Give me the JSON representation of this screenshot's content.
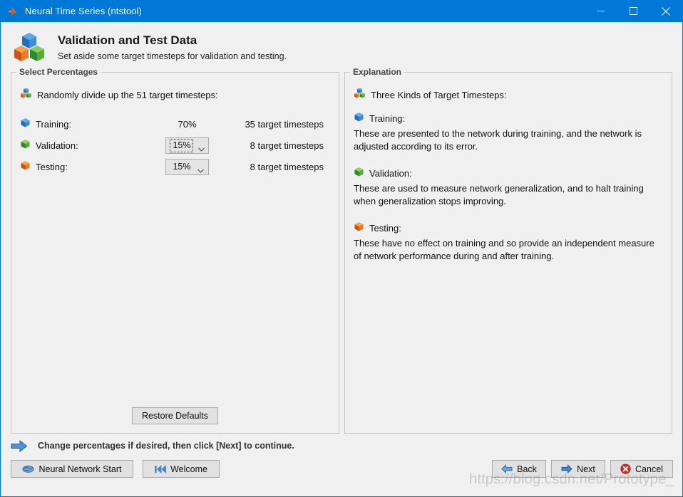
{
  "window": {
    "title": "Neural Time Series (ntstool)",
    "app_icon": "matlab-logo-icon",
    "minimize_label": "─",
    "maximize_label": "□",
    "close_label": "✕",
    "titlebar_color": "#0078d7"
  },
  "header": {
    "icon": "three-cubes-icon",
    "title": "Validation and Test Data",
    "subtitle": "Set aside some target timesteps for validation and testing."
  },
  "select_percentages": {
    "group_title": "Select Percentages",
    "intro_icon": "three-cubes-icon",
    "intro": "Randomly divide up the 51 target timesteps:",
    "rows": [
      {
        "icon": "blue-cube-icon",
        "icon_color": "#2e7bc4",
        "label": "Training:",
        "value": "70%",
        "editable": false,
        "count": "35 target timesteps"
      },
      {
        "icon": "green-cube-icon",
        "icon_color": "#3ea23e",
        "label": "Validation:",
        "value": "15%",
        "editable": true,
        "focused": true,
        "count": "8 target timesteps"
      },
      {
        "icon": "orange-cube-icon",
        "icon_color": "#e8701a",
        "label": "Testing:",
        "value": "15%",
        "editable": true,
        "focused": false,
        "count": "8 target timesteps"
      }
    ],
    "restore_button": "Restore Defaults"
  },
  "explanation": {
    "group_title": "Explanation",
    "heading_icon": "three-cubes-icon",
    "heading": "Three Kinds of Target Timesteps:",
    "sections": [
      {
        "icon": "blue-cube-icon",
        "title": "Training:",
        "body": "These are presented to the network during training, and the network is adjusted according to its error."
      },
      {
        "icon": "green-cube-icon",
        "title": "Validation:",
        "body": "These are used to measure network generalization, and to halt training when generalization stops improving."
      },
      {
        "icon": "orange-cube-icon",
        "title": "Testing:",
        "body": "These have no effect on training and so provide an independent measure of network performance during and after training."
      }
    ]
  },
  "hint": {
    "icon": "blue-right-arrow-icon",
    "text": "Change percentages if desired, then click [Next] to continue."
  },
  "footer": {
    "neural_network_start": {
      "icon": "brain-icon",
      "label": "Neural Network Start"
    },
    "welcome": {
      "icon": "skip-back-icon",
      "label": "Welcome"
    },
    "back": {
      "icon": "left-arrow-icon",
      "label": "Back"
    },
    "next": {
      "icon": "right-arrow-icon",
      "label": "Next"
    },
    "cancel": {
      "icon": "error-circle-icon",
      "label": "Cancel"
    }
  },
  "watermark": "https://blog.csdn.net/Prototype_"
}
